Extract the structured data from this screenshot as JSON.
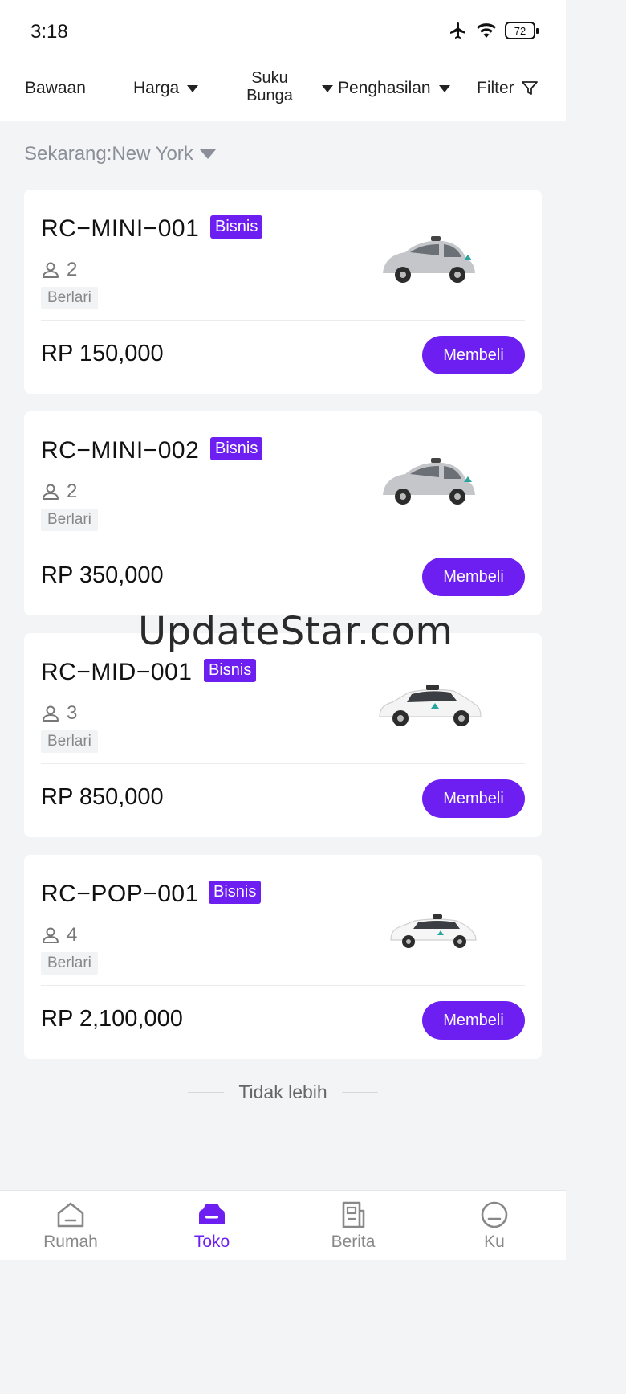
{
  "status_bar": {
    "time": "3:18",
    "battery": "72"
  },
  "filters": {
    "bawaan": "Bawaan",
    "harga": "Harga",
    "suku_line1": "Suku",
    "suku_line2": "Bunga",
    "penghasilan": "Penghasilan",
    "filter": "Filter"
  },
  "location": {
    "label": "Sekarang:New York"
  },
  "products": [
    {
      "name": "RC−MINI−001",
      "badge": "Bisnis",
      "seats": "2",
      "status": "Berlari",
      "price": "RP 150,000",
      "button": "Membeli",
      "car_icon": "small-car-icon"
    },
    {
      "name": "RC−MINI−002",
      "badge": "Bisnis",
      "seats": "2",
      "status": "Berlari",
      "price": "RP 350,000",
      "button": "Membeli",
      "car_icon": "small-car-icon"
    },
    {
      "name": "RC−MID−001",
      "badge": "Bisnis",
      "seats": "3",
      "status": "Berlari",
      "price": "RP 850,000",
      "button": "Membeli",
      "car_icon": "suv-icon"
    },
    {
      "name": "RC−POP−001",
      "badge": "Bisnis",
      "seats": "4",
      "status": "Berlari",
      "price": "RP 2,100,000",
      "button": "Membeli",
      "car_icon": "minivan-icon"
    }
  ],
  "end_text": "Tidak lebih",
  "watermark": "UpdateStar.com",
  "tabs": [
    {
      "label": "Rumah",
      "icon": "home-icon",
      "active": false
    },
    {
      "label": "Toko",
      "icon": "car-icon",
      "active": true
    },
    {
      "label": "Berita",
      "icon": "news-icon",
      "active": false
    },
    {
      "label": "Ku",
      "icon": "profile-icon",
      "active": false
    }
  ],
  "colors": {
    "accent": "#6d1ef0",
    "background": "#f3f4f6"
  }
}
